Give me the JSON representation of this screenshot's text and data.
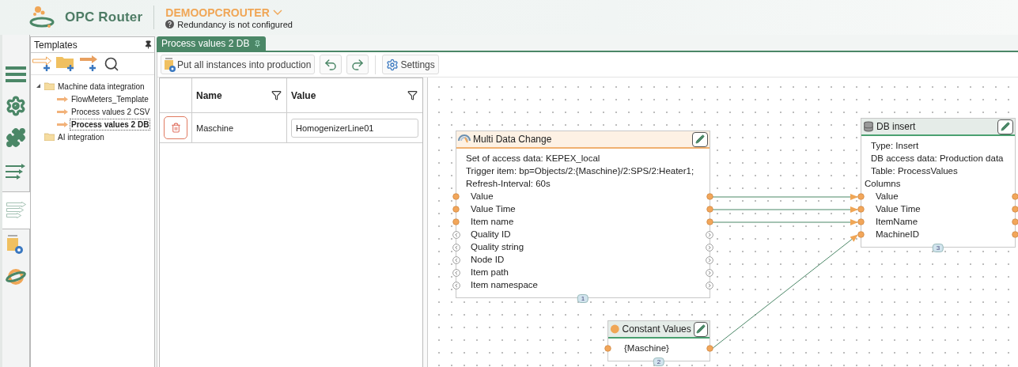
{
  "header": {
    "product": "OPC Router",
    "instance": "DEMOOPCROUTER",
    "redundancy": "Redundancy is not configured"
  },
  "rail": [
    {
      "kind": "menu",
      "selected": false
    },
    {
      "kind": "settings",
      "selected": false
    },
    {
      "kind": "plugins",
      "selected": false
    },
    {
      "kind": "connections",
      "selected": false
    },
    {
      "kind": "templates",
      "selected": true
    },
    {
      "kind": "projects",
      "selected": false
    },
    {
      "kind": "remote",
      "selected": false
    }
  ],
  "templates": {
    "title": "Templates",
    "tree": [
      {
        "label": "Machine data integration",
        "kind": "folder",
        "expanded": true,
        "children": [
          {
            "label": "FlowMeters_Template",
            "kind": "template",
            "selected": false
          },
          {
            "label": "Process values 2 CSV",
            "kind": "template",
            "selected": false
          },
          {
            "label": "Process values 2 DB",
            "kind": "template",
            "selected": true
          }
        ]
      },
      {
        "label": "AI integration",
        "kind": "folder"
      }
    ]
  },
  "tabs": [
    {
      "label": "Process values 2 DB",
      "selected": true
    }
  ],
  "toolbar": [
    {
      "kind": "production",
      "label": "Put all instances into production"
    },
    {
      "kind": "undo"
    },
    {
      "kind": "redo"
    },
    {
      "kind": "settings",
      "label": "Settings"
    }
  ],
  "table": {
    "columns": [
      "Name",
      "Value"
    ],
    "rows": [
      {
        "name": "Maschine",
        "value": "HomogenizerLine01"
      }
    ]
  },
  "canvas": {
    "nodes": [
      {
        "kind": "trigger",
        "title": "Multi Data Change",
        "info": [
          "Set of access data: KEPEX_local",
          "Trigger item: bp=Objects/2:{Maschine}/2:SPS/2:Heater1;",
          "Refresh-Interval: 60s"
        ],
        "rows": [
          {
            "label": "Value",
            "kind": "dot"
          },
          {
            "label": "Value Time",
            "kind": "dot"
          },
          {
            "label": "Item name",
            "kind": "dot"
          },
          {
            "label": "Quality ID",
            "kind": "chevron"
          },
          {
            "label": "Quality string",
            "kind": "chevron"
          },
          {
            "label": "Node ID",
            "kind": "chevron"
          },
          {
            "label": "Item path",
            "kind": "chevron"
          },
          {
            "label": "Item namespace",
            "kind": "chevron"
          }
        ],
        "badge": "1"
      },
      {
        "kind": "database",
        "title": "DB insert",
        "info": [
          "Type: Insert",
          "DB access data: Production data",
          "Table: ProcessValues"
        ],
        "section": "Columns",
        "rows": [
          {
            "label": "Value",
            "kind": "dot"
          },
          {
            "label": "Value Time",
            "kind": "dot"
          },
          {
            "label": "ItemName",
            "kind": "dot"
          },
          {
            "label": "MachineID",
            "kind": "dot"
          }
        ],
        "badge": "3"
      },
      {
        "kind": "constant",
        "title": "Constant Values",
        "rows": [
          {
            "label": "{Maschine}",
            "kind": "dot"
          }
        ],
        "badge": "2"
      }
    ]
  }
}
